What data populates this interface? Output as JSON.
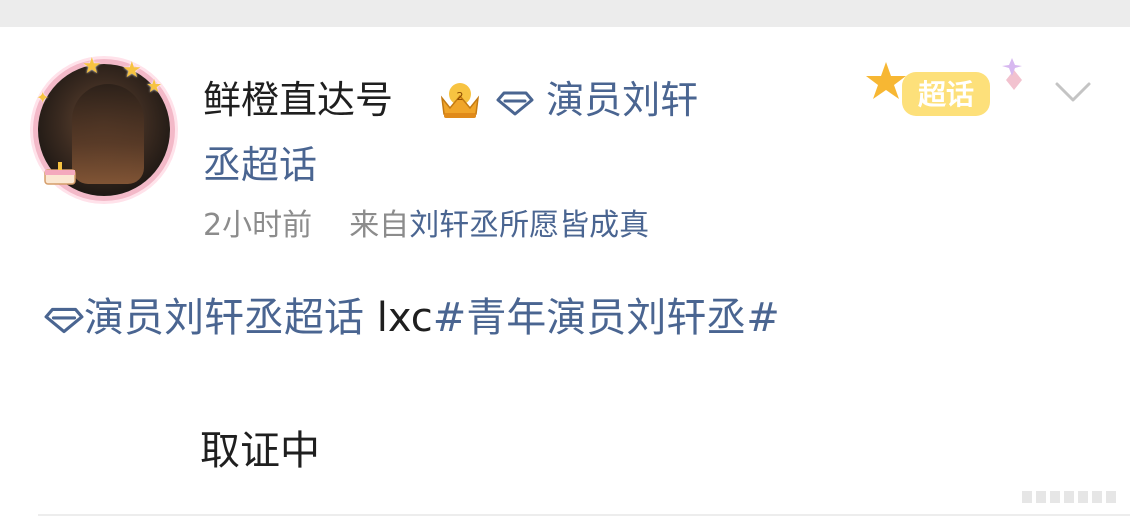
{
  "post": {
    "username": "鲜橙直达号",
    "topic_tag_part1": "演员刘轩",
    "topic_tag_part2": "丞超话",
    "time": "2小时前",
    "source_prefix": "来自",
    "source": "刘轩丞所愿皆成真",
    "content_topic": "演员刘轩丞超话",
    "content_text": " lxc",
    "content_hashtag": "#青年演员刘轩丞#",
    "body": "取证中",
    "badge_label": "超话"
  },
  "colors": {
    "link": "#4a6591",
    "text": "#1f1f1f",
    "meta": "#8c8c8c",
    "badge": "#f7c341"
  },
  "icons": [
    "diamond-icon",
    "crown-icon",
    "chevron-down-icon",
    "supertopic-badge-icon"
  ]
}
